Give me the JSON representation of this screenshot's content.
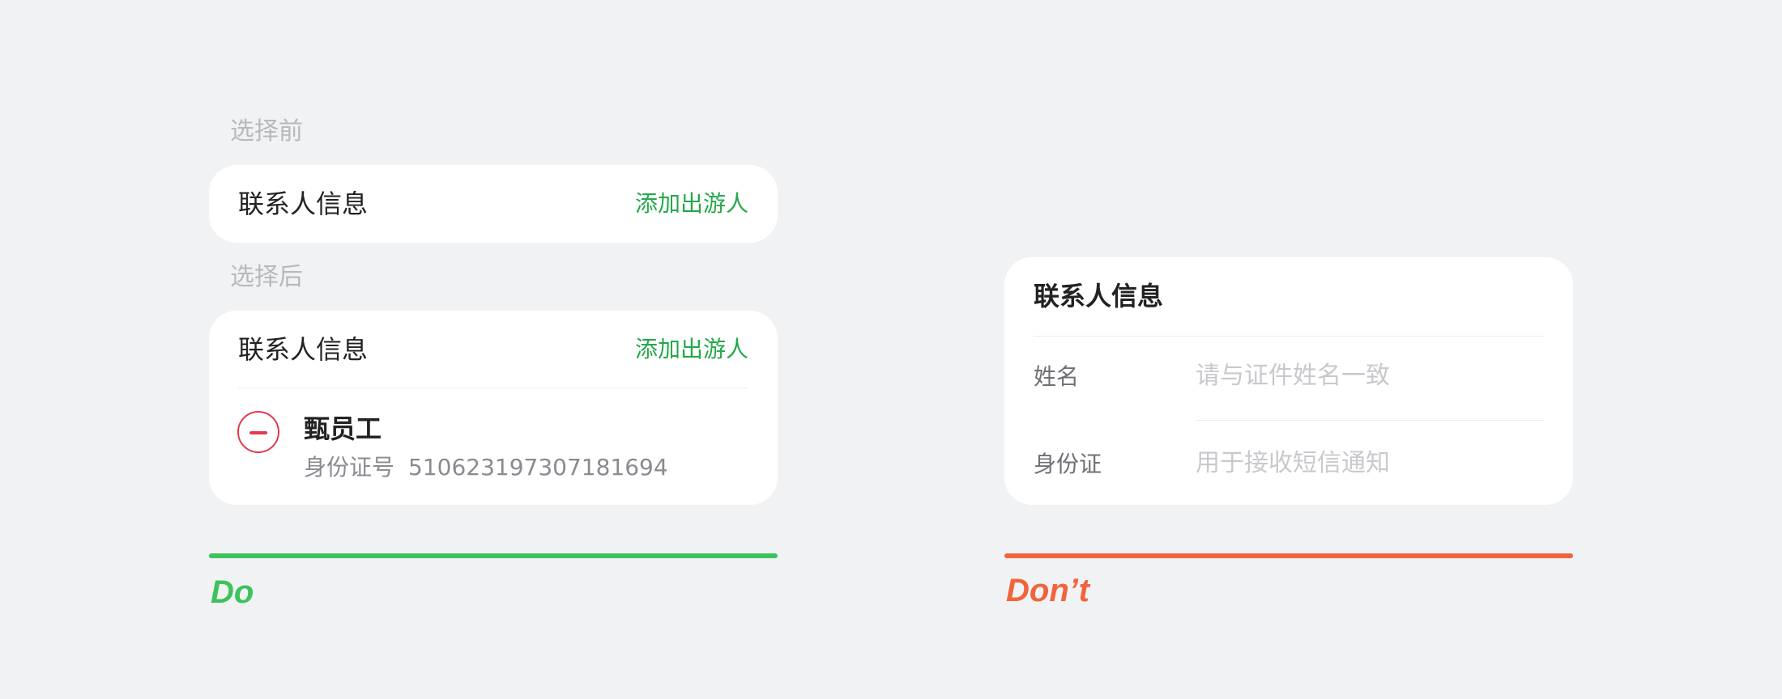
{
  "colors": {
    "background": "#f1f2f4",
    "card": "#ffffff",
    "accent_green": "#24a94a",
    "do_green": "#3cc35c",
    "dont_orange": "#f0643c",
    "remove_red": "#e23a4e"
  },
  "do_example": {
    "before": {
      "label": "选择前",
      "card": {
        "title": "联系人信息",
        "action": "添加出游人"
      }
    },
    "after": {
      "label": "选择后",
      "card": {
        "title": "联系人信息",
        "action": "添加出游人",
        "traveler": {
          "remove_icon": "minus-circle-icon",
          "name": "甄员工",
          "id_label": "身份证号",
          "id_number": "510623197307181694"
        }
      }
    },
    "verdict": "Do"
  },
  "dont_example": {
    "card": {
      "title": "联系人信息",
      "fields": [
        {
          "label": "姓名",
          "placeholder": "请与证件姓名一致"
        },
        {
          "label": "身份证",
          "placeholder": "用于接收短信通知"
        }
      ]
    },
    "verdict": "Don’t"
  }
}
